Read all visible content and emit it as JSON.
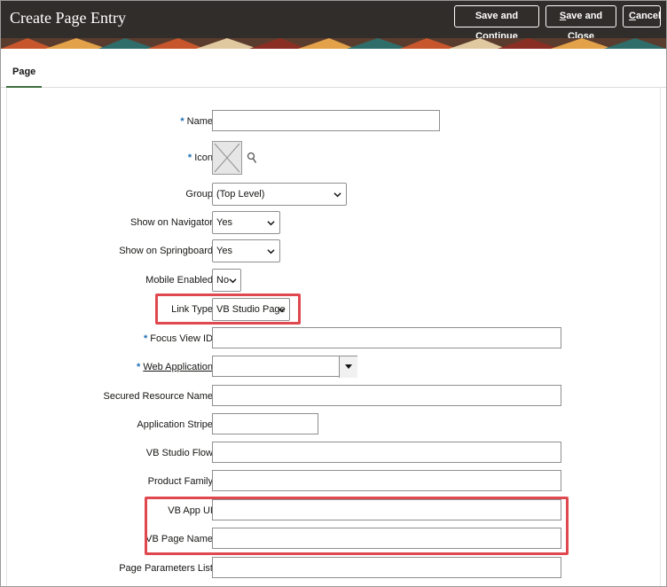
{
  "header": {
    "title": "Create Page Entry",
    "buttons": {
      "save_continue": "Save and Continue",
      "save_close_first": "S",
      "save_close_rest": "ave and Close",
      "cancel_first": "C",
      "cancel_rest": "ancel"
    }
  },
  "tabs": [
    {
      "label": "Page",
      "selected": true
    }
  ],
  "form": {
    "name": {
      "label": "Name",
      "required": true,
      "value": ""
    },
    "icon": {
      "label": "Icon",
      "required": true
    },
    "group": {
      "label": "Group",
      "value": "(Top Level)"
    },
    "show_on_navigator": {
      "label": "Show on Navigator",
      "value": "Yes"
    },
    "show_on_springboard": {
      "label": "Show on Springboard",
      "value": "Yes"
    },
    "mobile_enabled": {
      "label": "Mobile Enabled",
      "value": "No"
    },
    "link_type": {
      "label": "Link Type",
      "value": "VB Studio Page"
    },
    "focus_view_id": {
      "label": "Focus View ID",
      "required": true,
      "value": ""
    },
    "web_application": {
      "label": "Web Application",
      "required": true,
      "value": ""
    },
    "secured_resource_name": {
      "label": "Secured Resource Name",
      "value": ""
    },
    "application_stripe": {
      "label": "Application Stripe",
      "value": ""
    },
    "vb_studio_flow": {
      "label": "VB Studio Flow",
      "value": ""
    },
    "product_family": {
      "label": "Product Family",
      "value": ""
    },
    "vb_app_ui": {
      "label": "VB App UI",
      "value": ""
    },
    "vb_page_name": {
      "label": "VB Page Name",
      "value": ""
    },
    "page_parameters_list": {
      "label": "Page Parameters List",
      "value": ""
    }
  },
  "colors": {
    "header_bg": "#312d2a",
    "required_marker": "#1f6fb5",
    "highlight": "#e0484f",
    "tab_underline": "#3f6d3f"
  },
  "icons": [
    "image-placeholder-icon",
    "search-icon",
    "chevron-down-icon",
    "dropdown-arrow-icon"
  ]
}
